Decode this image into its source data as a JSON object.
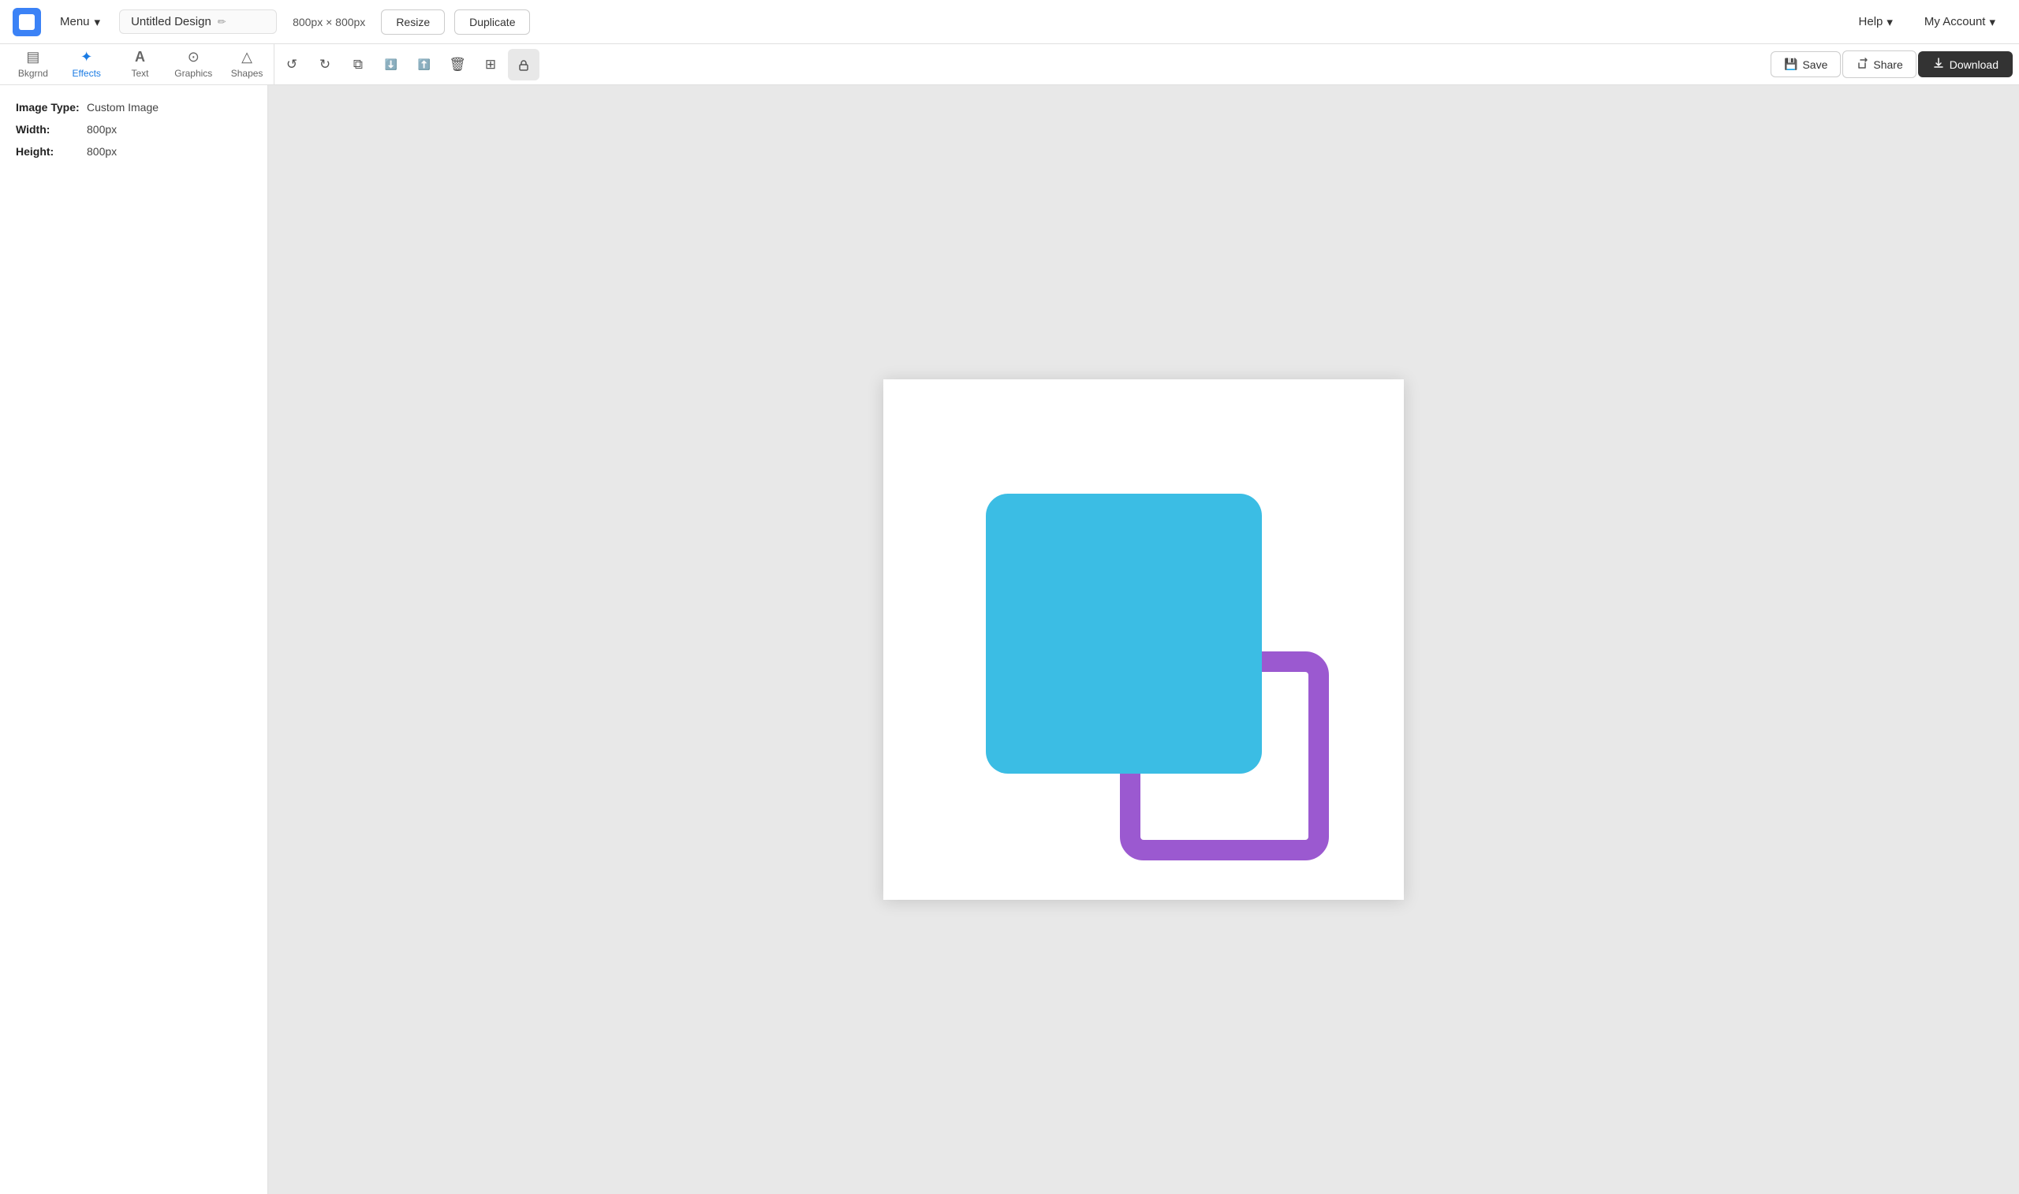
{
  "appLogo": {
    "alt": "App Logo"
  },
  "topNav": {
    "menuLabel": "Menu",
    "titleLabel": "Untitled Design",
    "editIcon": "✏",
    "canvasSize": "800px × 800px",
    "resizeLabel": "Resize",
    "duplicateLabel": "Duplicate",
    "helpLabel": "Help",
    "helpChevron": "▾",
    "accountLabel": "My Account",
    "accountChevron": "▾"
  },
  "toolbar": {
    "undoIcon": "↺",
    "redoIcon": "↻",
    "copyIcon": "⧉",
    "layerDownIcon": "⬇",
    "layerUpIcon": "⬆",
    "deleteIcon": "🗑",
    "gridIcon": "⊞",
    "lockIcon": "🔒",
    "saveLabel": "Save",
    "shareLabel": "Share",
    "downloadLabel": "Download",
    "saveIcon": "💾",
    "shareIcon": "↗",
    "downloadIcon": "⬇"
  },
  "sideTabs": [
    {
      "id": "bkgrnd",
      "label": "Bkgrnd",
      "icon": "▤",
      "active": false
    },
    {
      "id": "effects",
      "label": "Effects",
      "icon": "✦",
      "active": true
    },
    {
      "id": "text",
      "label": "Text",
      "icon": "T",
      "active": false
    },
    {
      "id": "graphics",
      "label": "Graphics",
      "icon": "⊙",
      "active": false
    },
    {
      "id": "shapes",
      "label": "Shapes",
      "icon": "△",
      "active": false
    }
  ],
  "panelInfo": {
    "imageTypeLabel": "Image Type:",
    "imageTypeValue": "Custom Image",
    "widthLabel": "Width:",
    "widthValue": "800px",
    "heightLabel": "Height:",
    "heightValue": "800px"
  },
  "canvas": {
    "shapes": {
      "blueColor": "#3bbde4",
      "purpleColor": "#9b59d0"
    }
  }
}
